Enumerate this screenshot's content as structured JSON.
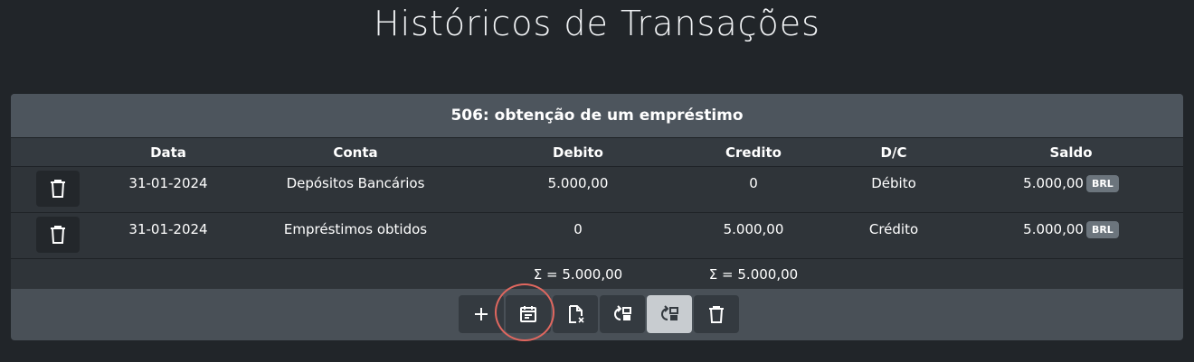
{
  "page": {
    "title": "Históricos de Transações"
  },
  "card": {
    "title": "506: obtenção de um empréstimo",
    "columns": [
      "Data",
      "Conta",
      "Debito",
      "Credito",
      "D/C",
      "Saldo"
    ],
    "rows": [
      {
        "date": "31-01-2024",
        "account": "Depósitos Bancários",
        "debit": "5.000,00",
        "credit": "0",
        "dc": "Débito",
        "balance": "5.000,00",
        "currency": "BRL"
      },
      {
        "date": "31-01-2024",
        "account": "Empréstimos obtidos",
        "debit": "0",
        "credit": "5.000,00",
        "dc": "Crédito",
        "balance": "5.000,00",
        "currency": "BRL"
      }
    ],
    "totals": {
      "debit": "Σ = 5.000,00",
      "credit": "Σ = 5.000,00"
    }
  },
  "toolbar": {
    "buttons": [
      {
        "icon": "plus-icon"
      },
      {
        "icon": "calendar-text-icon",
        "highlighted": true
      },
      {
        "icon": "file-remove-icon"
      },
      {
        "icon": "swap-left-icon"
      },
      {
        "icon": "swap-right-icon",
        "active": true
      },
      {
        "icon": "trash-icon"
      }
    ]
  },
  "colors": {
    "background": "#212529",
    "card": "#495057",
    "highlight": "#e0675f"
  }
}
